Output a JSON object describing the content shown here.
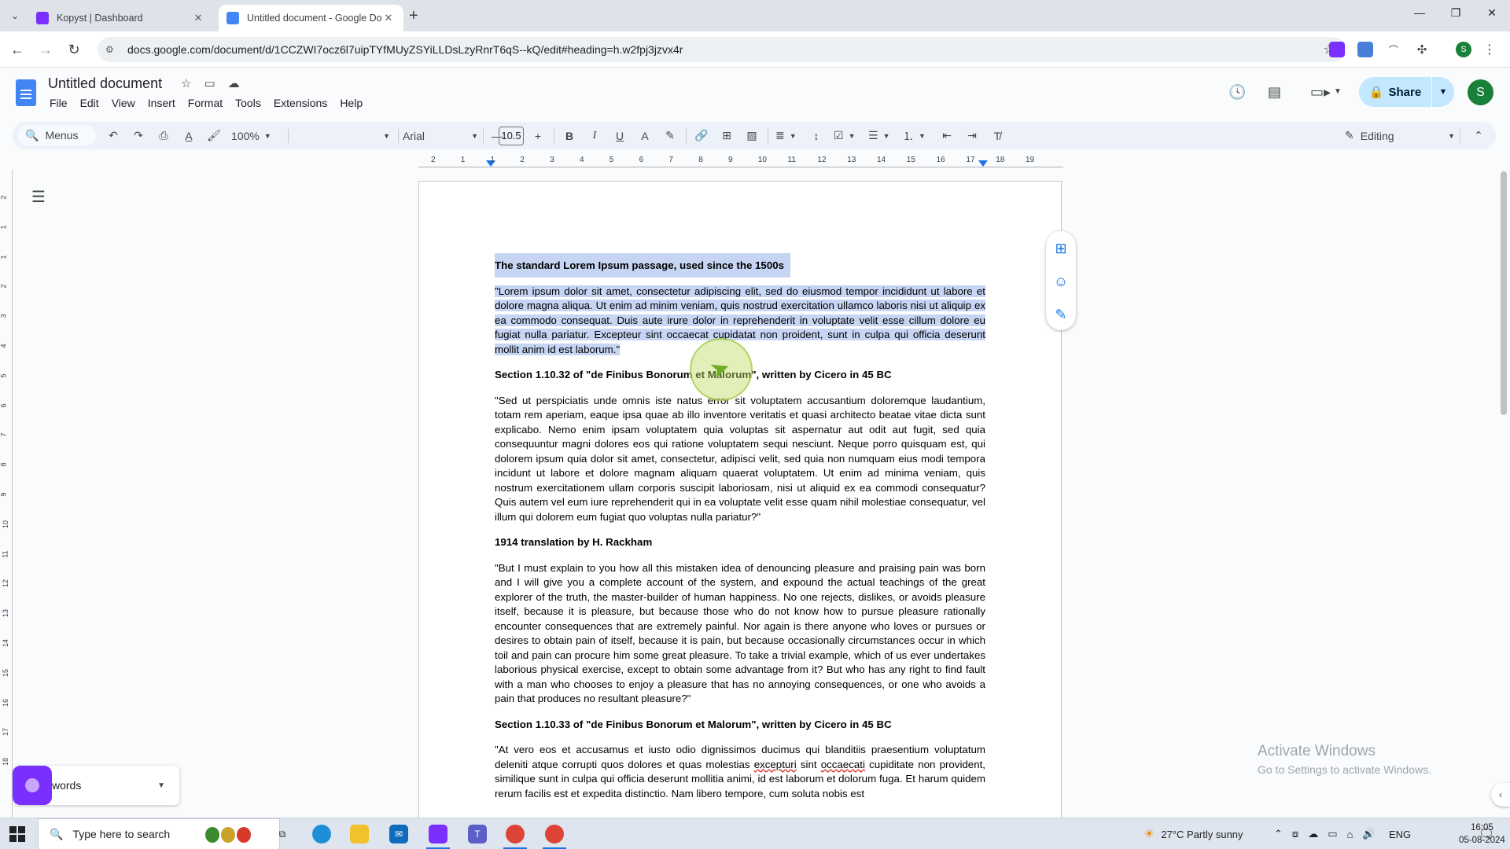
{
  "browser": {
    "tabs": [
      {
        "title": "Kopyst | Dashboard",
        "active": false
      },
      {
        "title": "Untitled document - Google Docs",
        "active": true
      }
    ],
    "url": "docs.google.com/document/d/1CCZWI7ocz6l7uipTYfMUyZSYiLLDsLzyRnrT6qS--kQ/edit#heading=h.w2fpj3jzvx4r",
    "profile_initial": "S"
  },
  "docs": {
    "title": "Untitled document",
    "menu": [
      "File",
      "Edit",
      "View",
      "Insert",
      "Format",
      "Tools",
      "Extensions",
      "Help"
    ],
    "share_label": "Share",
    "account_initial": "S",
    "toolbar": {
      "menus_label": "Menus",
      "zoom": "100%",
      "font": "Arial",
      "font_size": "10.5",
      "mode": "Editing"
    },
    "ruler_top": [
      "2",
      "1",
      "1",
      "2",
      "3",
      "4",
      "5",
      "6",
      "7",
      "8",
      "9",
      "10",
      "11",
      "12",
      "13",
      "14",
      "15",
      "16",
      "17",
      "18",
      "19"
    ],
    "ruler_left": [
      "2",
      "1",
      "1",
      "2",
      "3",
      "4",
      "5",
      "6",
      "7",
      "8",
      "9",
      "10",
      "11",
      "12",
      "13",
      "14",
      "15",
      "16",
      "17",
      "18"
    ],
    "word_count_label": "words",
    "content": {
      "h1": "The standard Lorem Ipsum passage, used since the 1500s",
      "p1": "\"Lorem ipsum dolor sit amet, consectetur adipiscing elit, sed do eiusmod tempor incididunt ut labore et dolore magna aliqua. Ut enim ad minim veniam, quis nostrud exercitation ullamco laboris nisi ut aliquip ex ea commodo consequat. Duis aute irure dolor in reprehenderit in voluptate velit esse cillum dolore eu fugiat nulla pariatur. Excepteur sint occaecat cupidatat non proident, sunt in culpa qui officia deserunt mollit anim id est laborum.\"",
      "h2": "Section 1.10.32 of \"de Finibus Bonorum et Malorum\", written by Cicero in 45 BC",
      "p2": "\"Sed ut perspiciatis unde omnis iste natus error sit voluptatem accusantium doloremque laudantium, totam rem aperiam, eaque ipsa quae ab illo inventore veritatis et quasi architecto beatae vitae dicta sunt explicabo. Nemo enim ipsam voluptatem quia voluptas sit aspernatur aut odit aut fugit, sed quia consequuntur magni dolores eos qui ratione voluptatem sequi nesciunt. Neque porro quisquam est, qui dolorem ipsum quia dolor sit amet, consectetur, adipisci velit, sed quia non numquam eius modi tempora incidunt ut labore et dolore magnam aliquam quaerat voluptatem. Ut enim ad minima veniam, quis nostrum exercitationem ullam corporis suscipit laboriosam, nisi ut aliquid ex ea commodi consequatur? Quis autem vel eum iure reprehenderit qui in ea voluptate velit esse quam nihil molestiae consequatur, vel illum qui dolorem eum fugiat quo voluptas nulla pariatur?\"",
      "h3": "1914 translation by H. Rackham",
      "p3": "\"But I must explain to you how all this mistaken idea of denouncing pleasure and praising pain was born and I will give you a complete account of the system, and expound the actual teachings of the great explorer of the truth, the master-builder of human happiness. No one rejects, dislikes, or avoids pleasure itself, because it is pleasure, but because those who do not know how to pursue pleasure rationally encounter consequences that are extremely painful. Nor again is there anyone who loves or pursues or desires to obtain pain of itself, because it is pain, but because occasionally circumstances occur in which toil and pain can procure him some great pleasure. To take a trivial example, which of us ever undertakes laborious physical exercise, except to obtain some advantage from it? But who has any right to find fault with a man who chooses to enjoy a pleasure that has no annoying consequences, or one who avoids a pain that produces no resultant pleasure?\"",
      "h4": "Section 1.10.33 of \"de Finibus Bonorum et Malorum\", written by Cicero in 45 BC",
      "p4_a": "\"At vero eos et accusamus et iusto odio dignissimos ducimus qui blanditiis praesentium voluptatum deleniti atque corrupti quos dolores et quas molestias ",
      "p4_err1": "excepturi",
      "p4_b": " sint ",
      "p4_err2": "occaecati",
      "p4_c": " cupiditate non provident, similique sunt in culpa qui officia deserunt mollitia animi, id est laborum et dolorum fuga. Et harum quidem rerum facilis est et expedita distinctio. Nam libero tempore, cum soluta nobis est"
    }
  },
  "watermark": {
    "line1": "Activate Windows",
    "line2": "Go to Settings to activate Windows."
  },
  "taskbar": {
    "search_placeholder": "Type here to search",
    "weather": "27°C  Partly sunny",
    "language": "ENG",
    "time": "16:05",
    "date": "05-08-2024"
  }
}
